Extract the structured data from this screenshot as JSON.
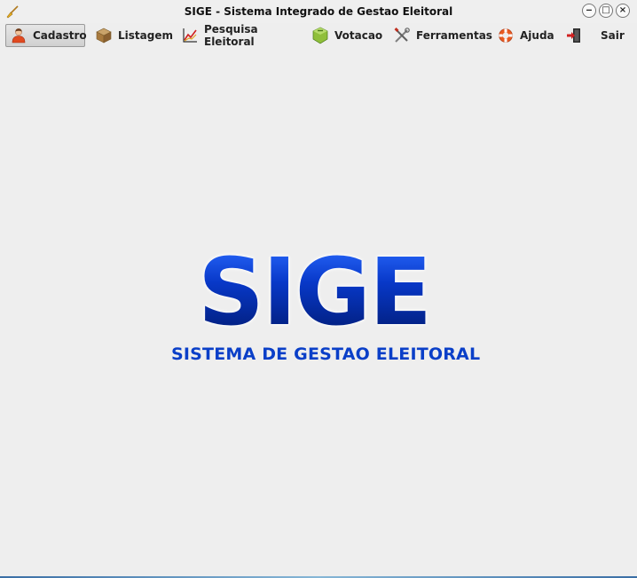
{
  "window": {
    "title": "SIGE - Sistema Integrado de Gestao Eleitoral",
    "controls": {
      "minimize": "‒",
      "maximize": "□",
      "close": "×"
    }
  },
  "menu": {
    "items": [
      {
        "label": "Cadastro",
        "icon": "user-icon",
        "active": true
      },
      {
        "label": "Listagem",
        "icon": "box-icon",
        "active": false
      },
      {
        "label": "Pesquisa Eleitoral",
        "icon": "chart-icon",
        "active": false
      },
      {
        "label": "Votacao",
        "icon": "ballot-box-icon",
        "active": false
      },
      {
        "label": "Ferramentas",
        "icon": "tools-icon",
        "active": false
      },
      {
        "label": "Ajuda",
        "icon": "lifebuoy-icon",
        "active": false
      },
      {
        "label": "Sair",
        "icon": "exit-door-icon",
        "active": false
      }
    ]
  },
  "logo": {
    "title": "SIGE",
    "subtitle": "SISTEMA DE GESTAO ELEITORAL",
    "colors": {
      "primary": "#0a35b8",
      "light": "#2a6bff",
      "dark": "#001a70"
    }
  }
}
